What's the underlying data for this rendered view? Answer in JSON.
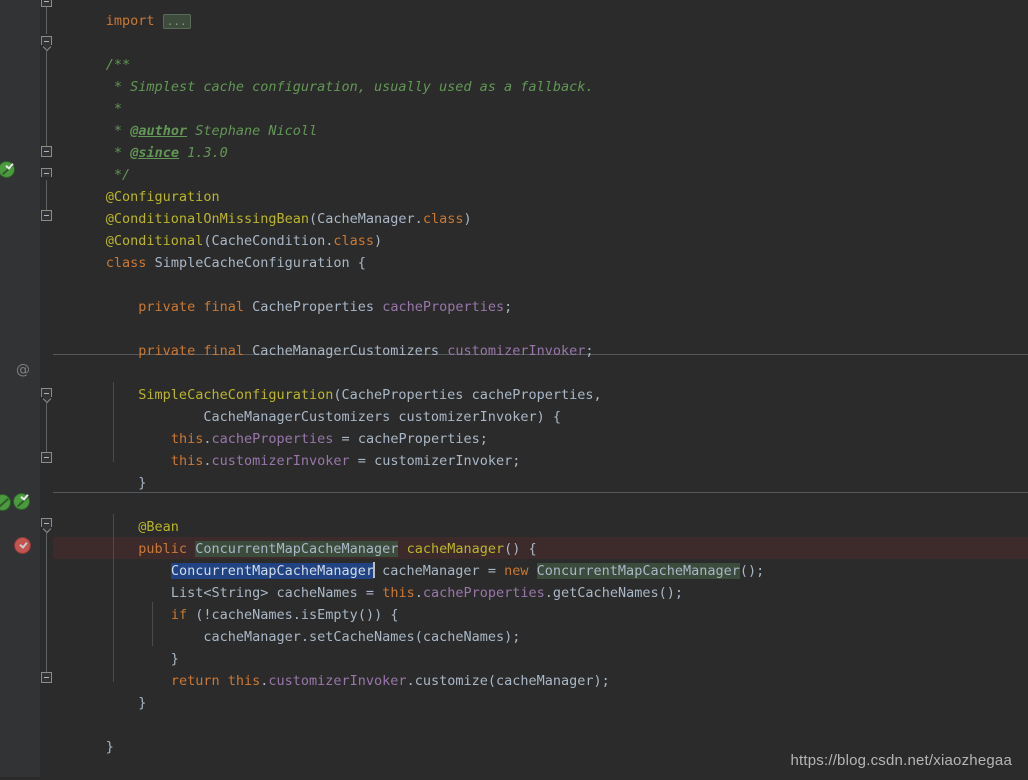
{
  "editor": {
    "theme": "darcula",
    "background": "#2B2B2B",
    "gutter_background": "#313335",
    "selection_color": "#214283",
    "identifier_highlight_color": "#3B4B3C",
    "error_row_color": "#3D2B2B",
    "language": "java"
  },
  "gutter": {
    "at_marker": "@",
    "icons": [
      {
        "name": "spring-bean-icon",
        "type": "bean-check",
        "line": 8
      },
      {
        "name": "spring-bean-navigate-icon",
        "type": "bean-arrow",
        "line": 23
      },
      {
        "name": "spring-bean-icon-2",
        "type": "bean-check",
        "line": 23
      },
      {
        "name": "breakpoint-verified-icon",
        "type": "breakpoint-check",
        "line": 25
      }
    ]
  },
  "code": {
    "lines": [
      {
        "n": 1,
        "text": "import ...",
        "kind": "import-folded"
      },
      {
        "n": 2,
        "text": "",
        "kind": "blank"
      },
      {
        "n": 3,
        "text": "/**",
        "kind": "javadoc"
      },
      {
        "n": 4,
        "text": " * Simplest cache configuration, usually used as a fallback.",
        "kind": "javadoc"
      },
      {
        "n": 5,
        "text": " *",
        "kind": "javadoc"
      },
      {
        "n": 6,
        "text": " * @author Stephane Nicoll",
        "kind": "javadoc"
      },
      {
        "n": 7,
        "text": " * @since 1.3.0",
        "kind": "javadoc"
      },
      {
        "n": 8,
        "text": " */",
        "kind": "javadoc"
      },
      {
        "n": 9,
        "text": "@Configuration",
        "kind": "annotation"
      },
      {
        "n": 10,
        "text": "@ConditionalOnMissingBean(CacheManager.class)",
        "kind": "annotation"
      },
      {
        "n": 11,
        "text": "@Conditional(CacheCondition.class)",
        "kind": "annotation"
      },
      {
        "n": 12,
        "text": "class SimpleCacheConfiguration {",
        "kind": "declaration"
      },
      {
        "n": 13,
        "text": "",
        "kind": "blank"
      },
      {
        "n": 14,
        "text": "    private final CacheProperties cacheProperties;",
        "kind": "field"
      },
      {
        "n": 15,
        "text": "",
        "kind": "blank"
      },
      {
        "n": 16,
        "text": "    private final CacheManagerCustomizers customizerInvoker;",
        "kind": "field"
      },
      {
        "n": 17,
        "text": "",
        "kind": "blank"
      },
      {
        "n": 18,
        "text": "    SimpleCacheConfiguration(CacheProperties cacheProperties,",
        "kind": "constructor"
      },
      {
        "n": 19,
        "text": "            CacheManagerCustomizers customizerInvoker) {",
        "kind": "constructor"
      },
      {
        "n": 20,
        "text": "        this.cacheProperties = cacheProperties;",
        "kind": "statement"
      },
      {
        "n": 21,
        "text": "        this.customizerInvoker = customizerInvoker;",
        "kind": "statement"
      },
      {
        "n": 22,
        "text": "    }",
        "kind": "brace"
      },
      {
        "n": 23,
        "text": "",
        "kind": "blank"
      },
      {
        "n": 24,
        "text": "    @Bean",
        "kind": "annotation"
      },
      {
        "n": 25,
        "text": "    public ConcurrentMapCacheManager cacheManager() {",
        "kind": "method"
      },
      {
        "n": 26,
        "text": "        ConcurrentMapCacheManager cacheManager = new ConcurrentMapCacheManager();",
        "kind": "statement"
      },
      {
        "n": 27,
        "text": "        List<String> cacheNames = this.cacheProperties.getCacheNames();",
        "kind": "statement"
      },
      {
        "n": 28,
        "text": "        if (!cacheNames.isEmpty()) {",
        "kind": "statement"
      },
      {
        "n": 29,
        "text": "            cacheManager.setCacheNames(cacheNames);",
        "kind": "statement"
      },
      {
        "n": 30,
        "text": "        }",
        "kind": "brace"
      },
      {
        "n": 31,
        "text": "        return this.customizerInvoker.customize(cacheManager);",
        "kind": "statement"
      },
      {
        "n": 32,
        "text": "    }",
        "kind": "brace"
      },
      {
        "n": 33,
        "text": "",
        "kind": "blank"
      },
      {
        "n": 34,
        "text": "}",
        "kind": "brace"
      }
    ],
    "tokens": {
      "import_kw": "import",
      "fold_placeholder": "...",
      "jdoc_open": "/**",
      "jdoc_star": " *",
      "jdoc_line1": " Simplest cache configuration, usually used as a fallback.",
      "jdoc_author_tag": "@author",
      "jdoc_author_value": " Stephane Nicoll",
      "jdoc_since_tag": "@since",
      "jdoc_since_value": " 1.3.0",
      "jdoc_close": " */",
      "anno_configuration": "@Configuration",
      "anno_conditional_on_missing_bean": "@ConditionalOnMissingBean",
      "anno_conditional": "@Conditional",
      "anno_bean": "@Bean",
      "kw_class": "class",
      "kw_private": "private",
      "kw_final": "final",
      "kw_public": "public",
      "kw_new": "new",
      "kw_this": "this",
      "kw_if": "if",
      "kw_return": "return",
      "type_cache_manager": "CacheManager",
      "type_cache_condition": "CacheCondition",
      "type_cache_properties": "CacheProperties",
      "type_cache_manager_customizers": "CacheManagerCustomizers",
      "type_concurrent_map_cache_manager": "ConcurrentMapCacheManager",
      "type_list_string": "List<String>",
      "class_name": "SimpleCacheConfiguration",
      "field_cache_properties": "cacheProperties",
      "field_customizer_invoker": "customizerInvoker",
      "var_cache_manager": "cacheManager",
      "var_cache_names": "cacheNames",
      "kw_class_literal": "class",
      "m_get_cache_names": "getCacheNames",
      "m_is_empty": "isEmpty",
      "m_set_cache_names": "setCacheNames",
      "m_customize": "customize"
    }
  },
  "watermark": {
    "text": "https://blog.csdn.net/xiaozhegaa"
  }
}
